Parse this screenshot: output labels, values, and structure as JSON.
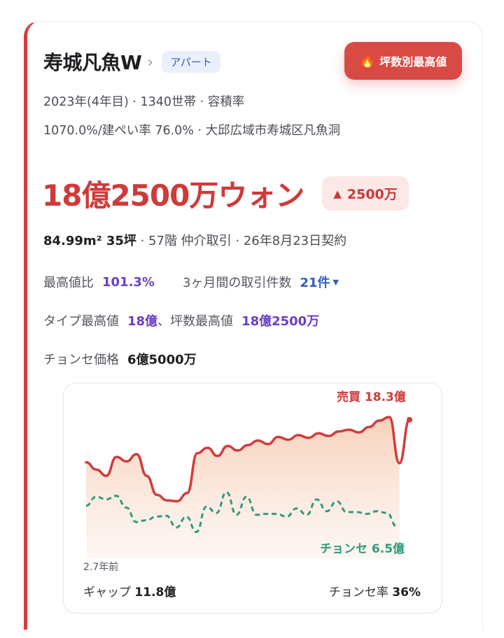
{
  "apartment": {
    "name": "寿城凡魚W",
    "chevron": "›",
    "type_badge": "アパート",
    "best_button_label": "坪数別最高値",
    "meta_line1": "2023年(4年目) · 1340世帯 · 容積率",
    "meta_line2": "1070.0%/建ぺい率 76.0% · 大邱広域市寿城区凡魚洞"
  },
  "price": {
    "main": "18億2500万ウォン",
    "change": "2500万",
    "change_direction": "up"
  },
  "detail": {
    "area": "84.99m² 35坪",
    "rest": " · 57階 仲介取引 · 26年8月23日契約"
  },
  "stats": {
    "peak_ratio_label": "最高値比",
    "peak_ratio_value": "101.3%",
    "trades_label": "3ヶ月間の取引件数",
    "trades_value": "21件",
    "type_high_label": "タイプ最高値",
    "type_high_value": "18億",
    "sep": "、",
    "pyeong_high_label": "坪数最高値",
    "pyeong_high_value": "18億2500万",
    "jeonse_label": "チョンセ価格",
    "jeonse_value": "6億5000万"
  },
  "chart": {
    "sale_label": "売買 18.3億",
    "jeonse_label": "チョンセ 6.5億",
    "period_label": "2.7年前",
    "gap_label": "ギャップ",
    "gap_value": "11.8億",
    "rate_label": "チョンセ率",
    "rate_value": "36%"
  },
  "colors": {
    "accent_red": "#cf3a3a",
    "jeonse_green": "#2f9a80",
    "purple": "#6a3fc3",
    "blue": "#2f5fbf"
  },
  "chart_data": {
    "type": "line",
    "ylim": [
      3,
      20
    ],
    "series": [
      {
        "name": "売買",
        "values": [
          13.6,
          12.8,
          12.1,
          14.2,
          13.7,
          14.5,
          12.1,
          10.0,
          9.4,
          9.3,
          10.2,
          14.6,
          15.2,
          14.3,
          15.4,
          14.9,
          15.5,
          16.0,
          15.6,
          16.4,
          16.1,
          16.6,
          16.3,
          16.8,
          16.5,
          17.0,
          17.2,
          16.9,
          17.5,
          18.2,
          18.6,
          13.5,
          18.3
        ]
      },
      {
        "name": "チョンセ",
        "values": [
          8.8,
          9.8,
          9.5,
          9.9,
          8.6,
          7.0,
          7.2,
          7.6,
          7.7,
          6.4,
          7.6,
          5.9,
          8.7,
          8.0,
          10.3,
          7.8,
          9.8,
          7.8,
          7.9,
          7.9,
          7.6,
          8.5,
          7.8,
          9.5,
          8.2,
          9.3,
          8.1,
          8.1,
          7.9,
          8.2,
          8.0,
          6.5
        ]
      }
    ]
  }
}
